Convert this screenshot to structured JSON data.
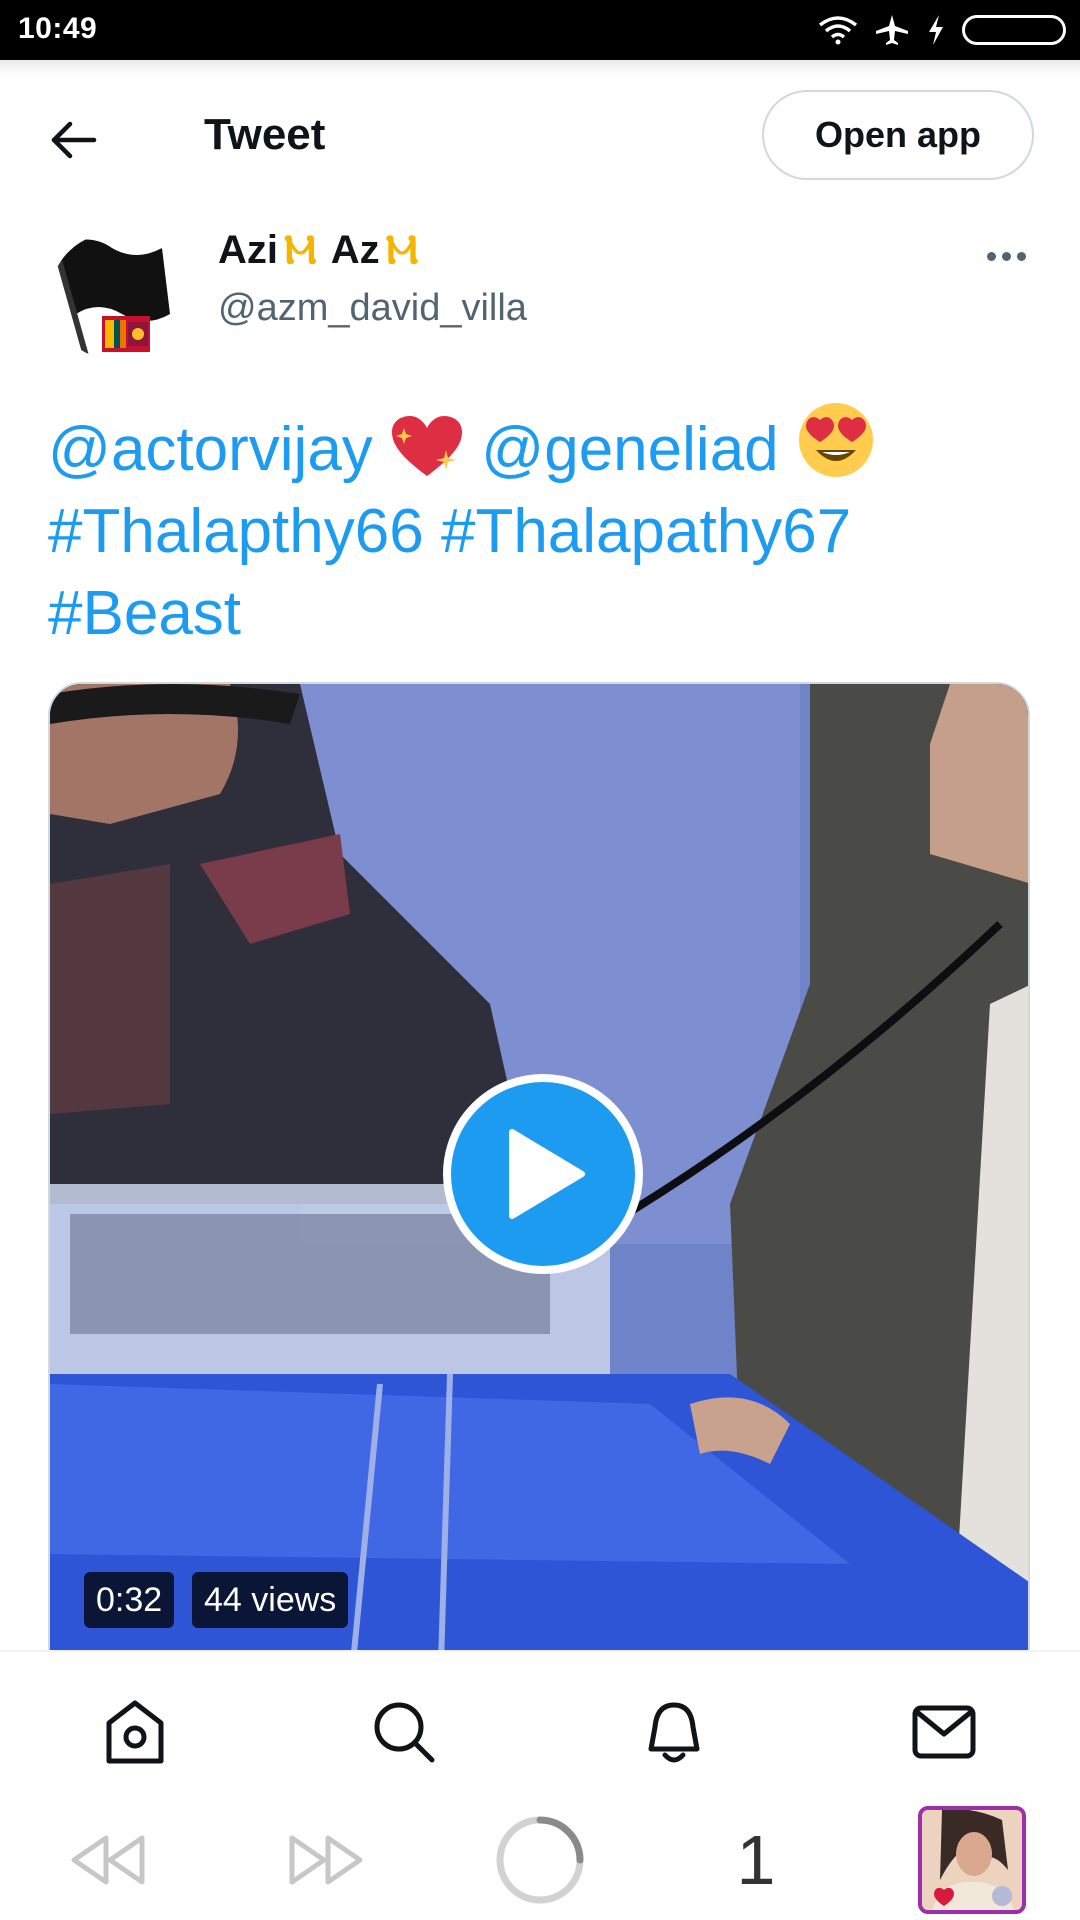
{
  "status_bar": {
    "time": "10:49",
    "icons": [
      "wifi-icon",
      "airplane-icon",
      "charging-icon",
      "battery-icon"
    ]
  },
  "header": {
    "title": "Tweet",
    "back_icon": "arrow-left-icon",
    "open_app_label": "Open app"
  },
  "tweet": {
    "author": {
      "name_part1": "Azi",
      "name_part2": "Az",
      "name_emoji": "Ⲙ",
      "handle": "@azm_david_villa"
    },
    "text": {
      "mention1": "@actorvijay",
      "mention2": "@geneliad",
      "hashtag1": "#Thalapthy66",
      "hashtag2": "#Thalapathy67",
      "hashtag3": "#Beast"
    },
    "video": {
      "duration": "0:32",
      "views": "44 views"
    }
  },
  "colors": {
    "accent": "#1d9bf0",
    "text_primary": "#0f1419",
    "text_secondary": "#536471",
    "border": "#cfd9de"
  },
  "bottom_nav": [
    "home-icon",
    "search-icon",
    "notifications-icon",
    "messages-icon"
  ],
  "browser_bar": {
    "tab_count": "1",
    "icons": [
      "rewind-icon",
      "fast-forward-icon",
      "loading-spinner-icon"
    ]
  }
}
